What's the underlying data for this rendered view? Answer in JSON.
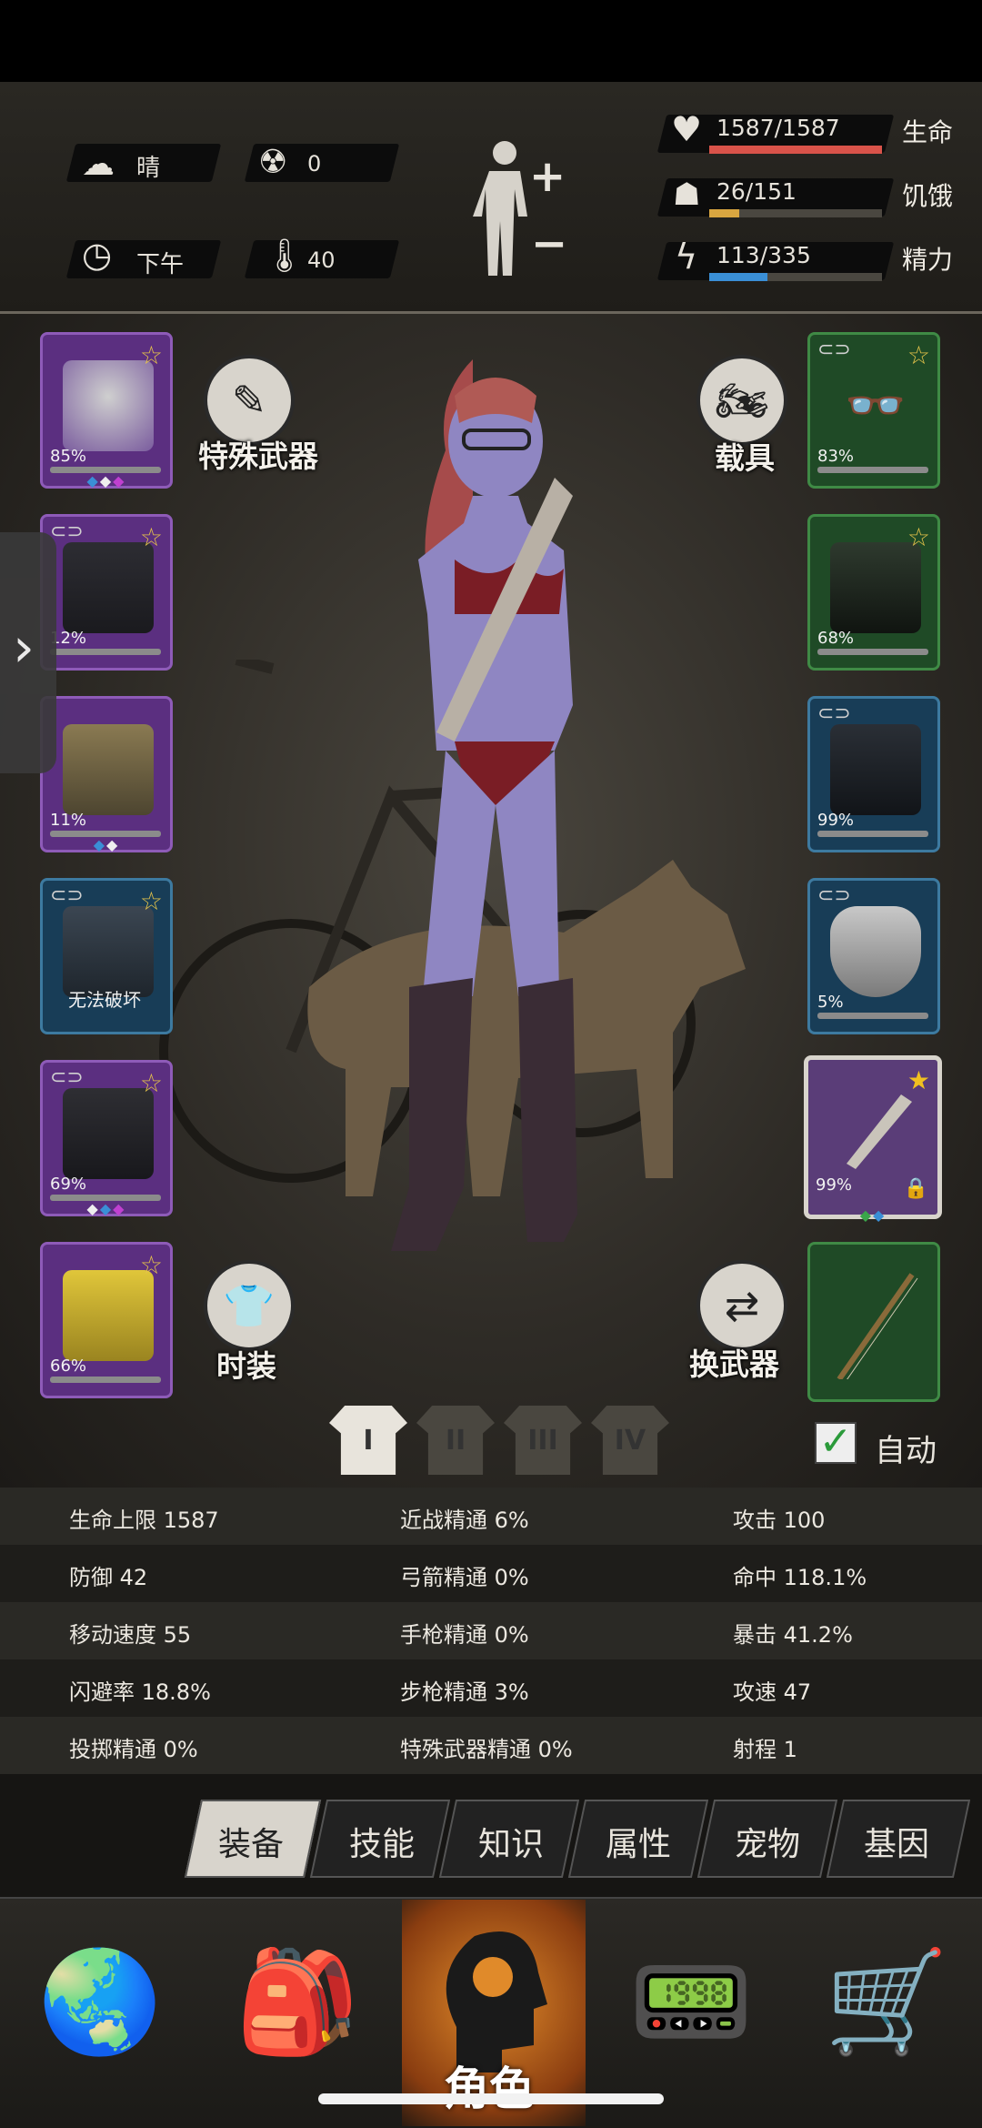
{
  "header": {
    "weather": "晴",
    "radiation": "0",
    "time_of_day": "下午",
    "temperature": "40",
    "health_value": "1587/1587",
    "health_label": "生命",
    "health_fraction": 1.0,
    "hunger_value": "26/151",
    "hunger_label": "饥饿",
    "hunger_fraction": 0.172,
    "energy_value": "113/335",
    "energy_label": "精力",
    "energy_fraction": 0.337,
    "colors": {
      "health": "#d9534a",
      "hunger": "#d9a640",
      "energy": "#3a8fd6"
    }
  },
  "left_slots": [
    {
      "pct": "85%",
      "gems": "◆◆◆",
      "item": "police-helmet"
    },
    {
      "pct": "12%",
      "gems": "",
      "item": "black-jacket"
    },
    {
      "pct": "11%",
      "gems": "◆◆",
      "item": "fur-coat"
    },
    {
      "pct": "无法破坏",
      "gems": "",
      "item": "backpack"
    },
    {
      "pct": "69%",
      "gems": "◆◆◆",
      "item": "cargo-pants"
    },
    {
      "pct": "66%",
      "gems": "",
      "item": "yellow-boots"
    }
  ],
  "right_slots": [
    {
      "pct": "83%",
      "item": "glasses"
    },
    {
      "pct": "68%",
      "item": "gas-mask"
    },
    {
      "pct": "99%",
      "item": "armor-vest"
    },
    {
      "pct": "5%",
      "item": "shield"
    },
    {
      "pct": "99%",
      "gems": "◆◆",
      "item": "machete"
    },
    {
      "pct": "",
      "item": "bow"
    }
  ],
  "buttons": {
    "special_weapon": "特殊武器",
    "vehicle": "载具",
    "fashion": "时装",
    "switch_weapon": "换武器",
    "auto": "自动"
  },
  "outfit_tabs": [
    "I",
    "II",
    "III",
    "IV"
  ],
  "stats": [
    [
      "生命上限 1587",
      "近战精通 6%",
      "攻击 100"
    ],
    [
      "防御 42",
      "弓箭精通 0%",
      "命中 118.1%"
    ],
    [
      "移动速度 55",
      "手枪精通 0%",
      "暴击 41.2%"
    ],
    [
      "闪避率 18.8%",
      "步枪精通 3%",
      "攻速 47"
    ],
    [
      "投掷精通 0%",
      "特殊武器精通 0%",
      "射程 1"
    ]
  ],
  "tabs": [
    "装备",
    "技能",
    "知识",
    "属性",
    "宠物",
    "基因"
  ],
  "nav": {
    "character_label": "角色"
  }
}
